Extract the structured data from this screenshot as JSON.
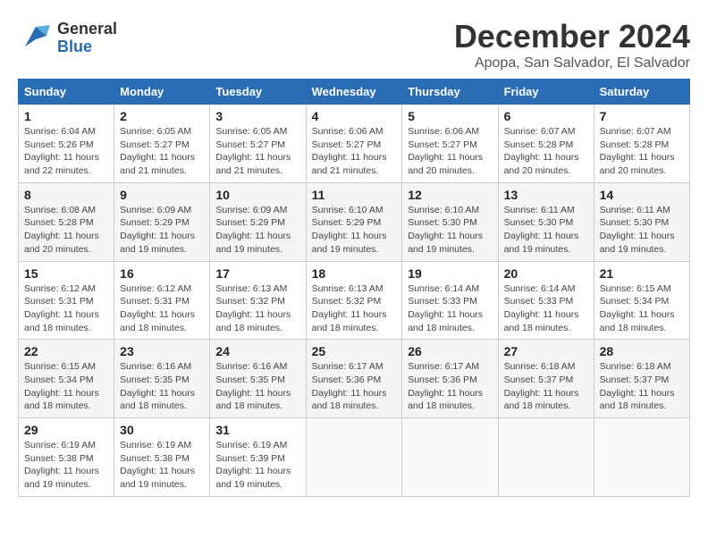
{
  "logo": {
    "part1": "General",
    "part2": "Blue"
  },
  "title": "December 2024",
  "location": "Apopa, San Salvador, El Salvador",
  "days_of_week": [
    "Sunday",
    "Monday",
    "Tuesday",
    "Wednesday",
    "Thursday",
    "Friday",
    "Saturday"
  ],
  "weeks": [
    [
      {
        "day": "1",
        "sunrise": "6:04 AM",
        "sunset": "5:26 PM",
        "daylight": "11 hours and 22 minutes."
      },
      {
        "day": "2",
        "sunrise": "6:05 AM",
        "sunset": "5:27 PM",
        "daylight": "11 hours and 21 minutes."
      },
      {
        "day": "3",
        "sunrise": "6:05 AM",
        "sunset": "5:27 PM",
        "daylight": "11 hours and 21 minutes."
      },
      {
        "day": "4",
        "sunrise": "6:06 AM",
        "sunset": "5:27 PM",
        "daylight": "11 hours and 21 minutes."
      },
      {
        "day": "5",
        "sunrise": "6:06 AM",
        "sunset": "5:27 PM",
        "daylight": "11 hours and 20 minutes."
      },
      {
        "day": "6",
        "sunrise": "6:07 AM",
        "sunset": "5:28 PM",
        "daylight": "11 hours and 20 minutes."
      },
      {
        "day": "7",
        "sunrise": "6:07 AM",
        "sunset": "5:28 PM",
        "daylight": "11 hours and 20 minutes."
      }
    ],
    [
      {
        "day": "8",
        "sunrise": "6:08 AM",
        "sunset": "5:28 PM",
        "daylight": "11 hours and 20 minutes."
      },
      {
        "day": "9",
        "sunrise": "6:09 AM",
        "sunset": "5:29 PM",
        "daylight": "11 hours and 19 minutes."
      },
      {
        "day": "10",
        "sunrise": "6:09 AM",
        "sunset": "5:29 PM",
        "daylight": "11 hours and 19 minutes."
      },
      {
        "day": "11",
        "sunrise": "6:10 AM",
        "sunset": "5:29 PM",
        "daylight": "11 hours and 19 minutes."
      },
      {
        "day": "12",
        "sunrise": "6:10 AM",
        "sunset": "5:30 PM",
        "daylight": "11 hours and 19 minutes."
      },
      {
        "day": "13",
        "sunrise": "6:11 AM",
        "sunset": "5:30 PM",
        "daylight": "11 hours and 19 minutes."
      },
      {
        "day": "14",
        "sunrise": "6:11 AM",
        "sunset": "5:30 PM",
        "daylight": "11 hours and 19 minutes."
      }
    ],
    [
      {
        "day": "15",
        "sunrise": "6:12 AM",
        "sunset": "5:31 PM",
        "daylight": "11 hours and 18 minutes."
      },
      {
        "day": "16",
        "sunrise": "6:12 AM",
        "sunset": "5:31 PM",
        "daylight": "11 hours and 18 minutes."
      },
      {
        "day": "17",
        "sunrise": "6:13 AM",
        "sunset": "5:32 PM",
        "daylight": "11 hours and 18 minutes."
      },
      {
        "day": "18",
        "sunrise": "6:13 AM",
        "sunset": "5:32 PM",
        "daylight": "11 hours and 18 minutes."
      },
      {
        "day": "19",
        "sunrise": "6:14 AM",
        "sunset": "5:33 PM",
        "daylight": "11 hours and 18 minutes."
      },
      {
        "day": "20",
        "sunrise": "6:14 AM",
        "sunset": "5:33 PM",
        "daylight": "11 hours and 18 minutes."
      },
      {
        "day": "21",
        "sunrise": "6:15 AM",
        "sunset": "5:34 PM",
        "daylight": "11 hours and 18 minutes."
      }
    ],
    [
      {
        "day": "22",
        "sunrise": "6:15 AM",
        "sunset": "5:34 PM",
        "daylight": "11 hours and 18 minutes."
      },
      {
        "day": "23",
        "sunrise": "6:16 AM",
        "sunset": "5:35 PM",
        "daylight": "11 hours and 18 minutes."
      },
      {
        "day": "24",
        "sunrise": "6:16 AM",
        "sunset": "5:35 PM",
        "daylight": "11 hours and 18 minutes."
      },
      {
        "day": "25",
        "sunrise": "6:17 AM",
        "sunset": "5:36 PM",
        "daylight": "11 hours and 18 minutes."
      },
      {
        "day": "26",
        "sunrise": "6:17 AM",
        "sunset": "5:36 PM",
        "daylight": "11 hours and 18 minutes."
      },
      {
        "day": "27",
        "sunrise": "6:18 AM",
        "sunset": "5:37 PM",
        "daylight": "11 hours and 18 minutes."
      },
      {
        "day": "28",
        "sunrise": "6:18 AM",
        "sunset": "5:37 PM",
        "daylight": "11 hours and 18 minutes."
      }
    ],
    [
      {
        "day": "29",
        "sunrise": "6:19 AM",
        "sunset": "5:38 PM",
        "daylight": "11 hours and 19 minutes."
      },
      {
        "day": "30",
        "sunrise": "6:19 AM",
        "sunset": "5:38 PM",
        "daylight": "11 hours and 19 minutes."
      },
      {
        "day": "31",
        "sunrise": "6:19 AM",
        "sunset": "5:39 PM",
        "daylight": "11 hours and 19 minutes."
      },
      null,
      null,
      null,
      null
    ]
  ],
  "labels": {
    "sunrise": "Sunrise:",
    "sunset": "Sunset:",
    "daylight": "Daylight:"
  }
}
